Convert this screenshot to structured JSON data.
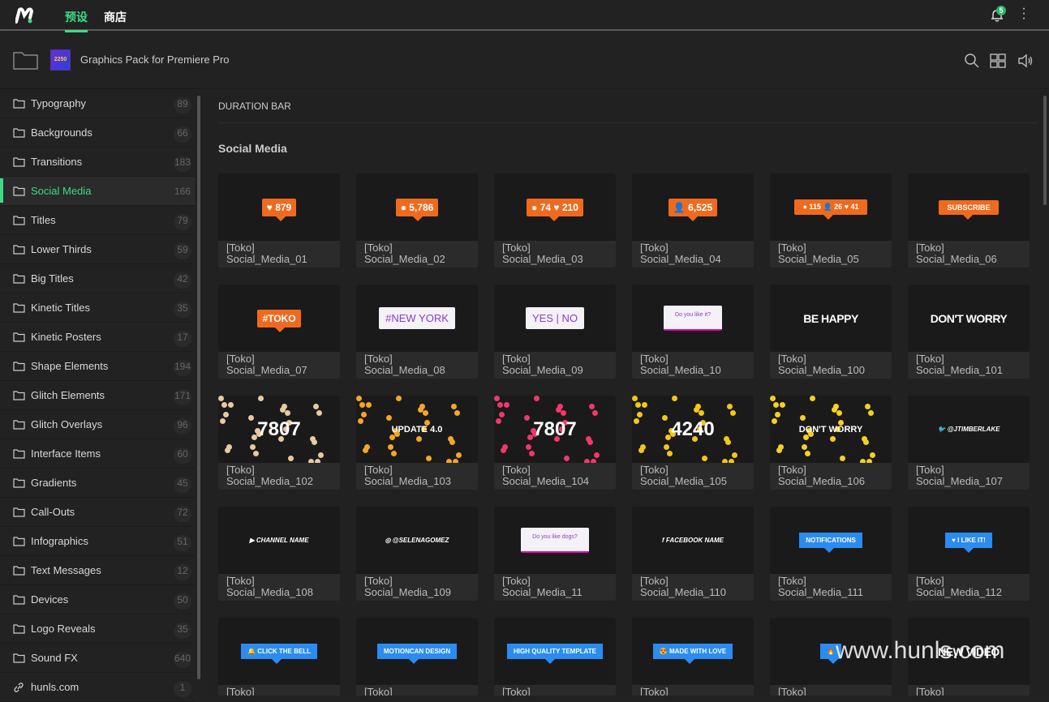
{
  "topbar": {
    "tabs": [
      {
        "label": "预设",
        "active": true
      },
      {
        "label": "商店",
        "active": false
      }
    ],
    "notification_count": "5"
  },
  "header": {
    "pack_title": "Graphics Pack for Premiere Pro",
    "pack_thumb_text": "2250"
  },
  "sidebar": {
    "items": [
      {
        "label": "Typography",
        "count": "89"
      },
      {
        "label": "Backgrounds",
        "count": "66"
      },
      {
        "label": "Transitions",
        "count": "183"
      },
      {
        "label": "Social Media",
        "count": "166",
        "active": true
      },
      {
        "label": "Titles",
        "count": "79"
      },
      {
        "label": "Lower Thirds",
        "count": "59"
      },
      {
        "label": "Big Titles",
        "count": "42"
      },
      {
        "label": "Kinetic Titles",
        "count": "35"
      },
      {
        "label": "Kinetic Posters",
        "count": "17"
      },
      {
        "label": "Shape Elements",
        "count": "194"
      },
      {
        "label": "Glitch Elements",
        "count": "171"
      },
      {
        "label": "Glitch Overlays",
        "count": "96"
      },
      {
        "label": "Interface Items",
        "count": "60"
      },
      {
        "label": "Gradients",
        "count": "45"
      },
      {
        "label": "Call-Outs",
        "count": "72"
      },
      {
        "label": "Infographics",
        "count": "51"
      },
      {
        "label": "Text Messages",
        "count": "12"
      },
      {
        "label": "Devices",
        "count": "50"
      },
      {
        "label": "Logo Reveals",
        "count": "35"
      },
      {
        "label": "Sound FX",
        "count": "640"
      },
      {
        "label": "hunls.com",
        "count": "1",
        "link": true
      }
    ]
  },
  "main": {
    "section_duration": "DURATION BAR",
    "section_title": "Social Media",
    "cards": [
      {
        "name": "[Toko]\nSocial_Media_01",
        "thumb": "♥ 879",
        "style": "orange"
      },
      {
        "name": "[Toko]\nSocial_Media_02",
        "thumb": "● 5,786",
        "style": "orange"
      },
      {
        "name": "[Toko]\nSocial_Media_03",
        "thumb": "● 74 ♥ 210",
        "style": "orange"
      },
      {
        "name": "[Toko]\nSocial_Media_04",
        "thumb": "👤 6,525",
        "style": "orange"
      },
      {
        "name": "[Toko]\nSocial_Media_05",
        "thumb": "● 115 👤 26 ♥ 41",
        "style": "orange-s"
      },
      {
        "name": "[Toko]\nSocial_Media_06",
        "thumb": "SUBSCRIBE",
        "style": "orange-s"
      },
      {
        "name": "[Toko]\nSocial_Media_07",
        "thumb": "#TOKO",
        "style": "orange"
      },
      {
        "name": "[Toko]\nSocial_Media_08",
        "thumb": "#NEW YORK",
        "style": "white"
      },
      {
        "name": "[Toko]\nSocial_Media_09",
        "thumb": "YES | NO",
        "style": "white"
      },
      {
        "name": "[Toko]\nSocial_Media_10",
        "thumb": "Do you like it?",
        "style": "white-s"
      },
      {
        "name": "[Toko]\nSocial_Media_100",
        "thumb": "BE HAPPY",
        "style": "plain"
      },
      {
        "name": "[Toko]\nSocial_Media_101",
        "thumb": "DON'T WORRY",
        "style": "plain"
      },
      {
        "name": "[Toko]\nSocial_Media_102",
        "thumb": "7807",
        "style": "emoji",
        "color": "#e8c9a0"
      },
      {
        "name": "[Toko]\nSocial_Media_103",
        "thumb": "UPDATE 4.0",
        "style": "emoji-s",
        "color": "#f5a623"
      },
      {
        "name": "[Toko]\nSocial_Media_104",
        "thumb": "7807",
        "style": "emoji",
        "color": "#f0386b"
      },
      {
        "name": "[Toko]\nSocial_Media_105",
        "thumb": "4240",
        "style": "emoji",
        "color": "#f5c518"
      },
      {
        "name": "[Toko]\nSocial_Media_106",
        "thumb": "DON'T WORRY",
        "style": "emoji-s",
        "color": "#f5d020"
      },
      {
        "name": "[Toko]\nSocial_Media_107",
        "thumb": "🐦 @JTIMBERLAKE",
        "style": "small"
      },
      {
        "name": "[Toko]\nSocial_Media_108",
        "thumb": "▶ CHANNEL NAME",
        "style": "small"
      },
      {
        "name": "[Toko]\nSocial_Media_109",
        "thumb": "◎ @SELENAGOMEZ",
        "style": "small"
      },
      {
        "name": "[Toko]\nSocial_Media_11",
        "thumb": "Do you like dogs?",
        "style": "white-s"
      },
      {
        "name": "[Toko]\nSocial_Media_110",
        "thumb": "f FACEBOOK NAME",
        "style": "small"
      },
      {
        "name": "[Toko]\nSocial_Media_111",
        "thumb": "NOTIFICATIONS",
        "style": "blue"
      },
      {
        "name": "[Toko]\nSocial_Media_112",
        "thumb": "♥ I LIKE IT!",
        "style": "blue"
      },
      {
        "name": "[Toko]",
        "thumb": "🔔 CLICK THE BELL",
        "style": "blue"
      },
      {
        "name": "[Toko]",
        "thumb": "MOTIONCAN DESIGN",
        "style": "blue"
      },
      {
        "name": "[Toko]",
        "thumb": "HIGH QUALITY TEMPLATE",
        "style": "blue"
      },
      {
        "name": "[Toko]",
        "thumb": "😍 MADE WITH LOVE",
        "style": "blue"
      },
      {
        "name": "[Toko]",
        "thumb": "🔥",
        "style": "blue"
      },
      {
        "name": "[Toko]",
        "thumb": "NEW VIDEO",
        "style": "plain"
      }
    ]
  },
  "watermark": "www.hunls.com",
  "colors": {
    "accent": "#3ddc84",
    "orange": "#f06a1e",
    "blue": "#2a8cf0"
  }
}
